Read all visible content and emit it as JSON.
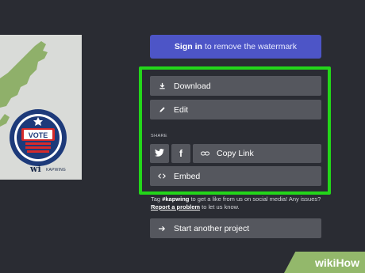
{
  "preview": {
    "watermark_main": "wi",
    "watermark_sub": "KAPWING",
    "badge_text": "VOTE"
  },
  "signin": {
    "bold": "Sign in",
    "rest": "to remove the watermark"
  },
  "actions": {
    "download": "Download",
    "edit": "Edit",
    "share_label": "SHARE",
    "copy_link": "Copy Link",
    "embed": "Embed"
  },
  "tagline": {
    "part1": "Tag ",
    "hashtag": "#kapwing",
    "part2": " to get a like from us on social media! Any issues? ",
    "report_link": "Report a problem",
    "part3": " to let us know."
  },
  "another_project": "Start another project",
  "brand": "wikiHow",
  "colors": {
    "background": "#2a2c33",
    "signin": "#4d55c7",
    "button": "#55575e",
    "highlight": "#23d61a"
  },
  "icons": [
    "download-icon",
    "pencil-icon",
    "twitter-icon",
    "facebook-icon",
    "link-icon",
    "code-icon",
    "arrow-right-icon"
  ]
}
